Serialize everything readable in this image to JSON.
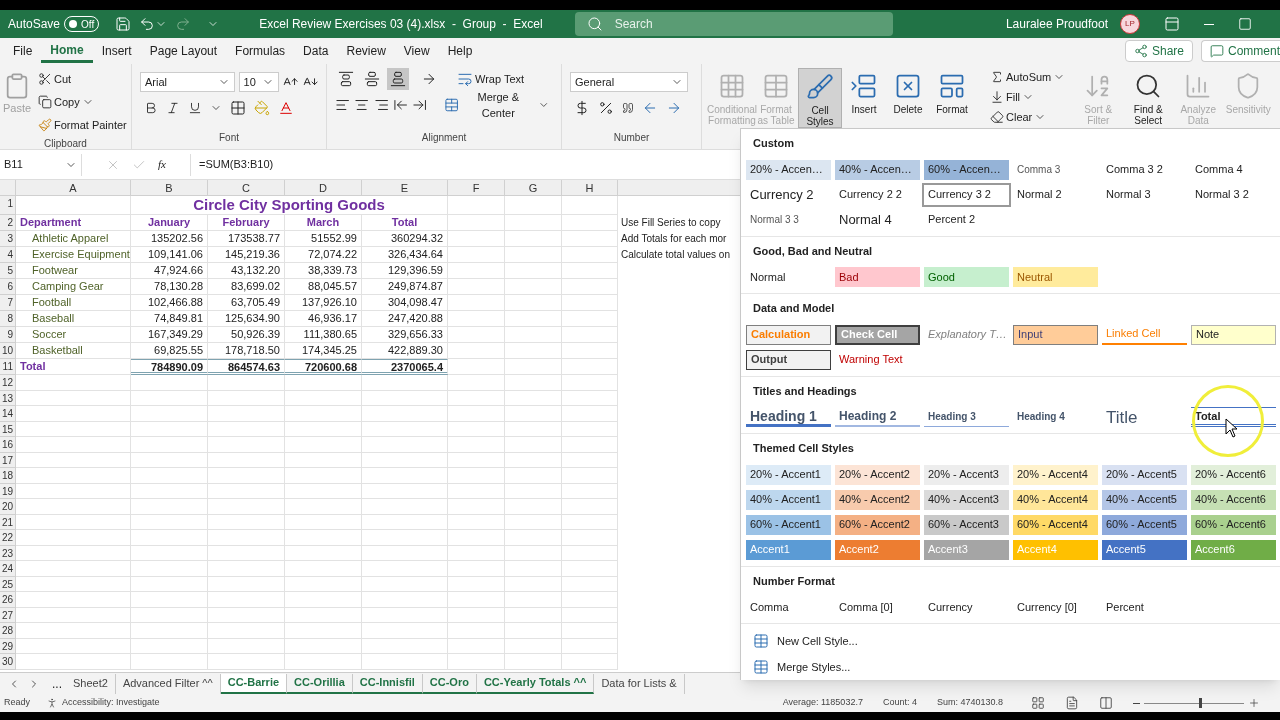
{
  "title_bar": {
    "autosave_label": "AutoSave",
    "autosave": {
      "on": false,
      "label": "Off"
    },
    "document_title": "Excel Review Exercises 03 (4).xlsx  -  Group  -  Excel",
    "search_placeholder": "Search",
    "user_name": "Lauralee Proudfoot",
    "user_initials": "LP"
  },
  "menu_tabs": [
    {
      "label": "File",
      "selected": false
    },
    {
      "label": "Home",
      "selected": true
    },
    {
      "label": "Insert",
      "selected": false
    },
    {
      "label": "Page Layout",
      "selected": false
    },
    {
      "label": "Formulas",
      "selected": false
    },
    {
      "label": "Data",
      "selected": false
    },
    {
      "label": "Review",
      "selected": false
    },
    {
      "label": "View",
      "selected": false
    },
    {
      "label": "Help",
      "selected": false
    }
  ],
  "share_label": "Share",
  "comments_label": "Comment",
  "ribbon": {
    "clipboard": {
      "label": "Clipboard",
      "paste": {
        "label": "Paste",
        "disabled": true
      },
      "cut": "Cut",
      "copy": "Copy",
      "format_painter": "Format Painter"
    },
    "font": {
      "label": "Font",
      "name": "Arial",
      "size": "10"
    },
    "alignment": {
      "label": "Alignment",
      "wrap_text": "Wrap Text",
      "merge": "Merge & Center",
      "vertical_align": [
        {
          "selected": false
        },
        {
          "selected": false
        },
        {
          "selected": true
        }
      ]
    },
    "number": {
      "label": "Number",
      "format": "General"
    },
    "big_buttons": [
      {
        "label": "Conditional Formatting",
        "disabled": true,
        "selected": false
      },
      {
        "label": "Format as Table",
        "disabled": true,
        "selected": false
      },
      {
        "label": "Cell Styles",
        "disabled": false,
        "selected": true
      },
      {
        "label": "Insert",
        "disabled": false,
        "selected": false
      },
      {
        "label": "Delete",
        "disabled": false,
        "selected": false
      },
      {
        "label": "Format",
        "disabled": false,
        "selected": false
      }
    ],
    "editing": [
      "AutoSum",
      "Fill",
      "Clear"
    ],
    "right_buttons": [
      {
        "label": "Sort & Filter",
        "disabled": true
      },
      {
        "label": "Find & Select",
        "disabled": false
      },
      {
        "label": "Analyze Data",
        "disabled": true
      },
      {
        "label": "Sensitivity",
        "disabled": true
      }
    ]
  },
  "formula_bar": {
    "name_box": "B11",
    "fx": "fx",
    "formula": "=SUM(B3:B10)"
  },
  "sheet": {
    "columns": [
      "A",
      "B",
      "C",
      "D",
      "E",
      "F",
      "G",
      "H"
    ],
    "row_numbers": [
      "1",
      "2",
      "3",
      "4",
      "5",
      "6",
      "7",
      "8",
      "9",
      "10",
      "11",
      "12",
      "13",
      "14",
      "15",
      "16",
      "17",
      "18",
      "19",
      "20",
      "21",
      "22",
      "23",
      "24",
      "25",
      "26",
      "27",
      "28",
      "29",
      "30"
    ],
    "title": "Circle City Sporting Goods",
    "header": [
      "Department",
      "January",
      "February",
      "March",
      "Total"
    ],
    "rows": [
      [
        "Athletic Apparel",
        "135202.56",
        "173538.77",
        "51552.99",
        "360294.32"
      ],
      [
        "Exercise Equipment",
        "109,141.06",
        "145,219.36",
        "72,074.22",
        "326,434.64"
      ],
      [
        "Footwear",
        "47,924.66",
        "43,132.20",
        "38,339.73",
        "129,396.59"
      ],
      [
        "Camping Gear",
        "78,130.28",
        "83,699.02",
        "88,045.57",
        "249,874.87"
      ],
      [
        "Football",
        "102,466.88",
        "63,705.49",
        "137,926.10",
        "304,098.47"
      ],
      [
        "Baseball",
        "74,849.81",
        "125,634.90",
        "46,936.17",
        "247,420.88"
      ],
      [
        "Soccer",
        "167,349.29",
        "50,926.39",
        "111,380.65",
        "329,656.33"
      ],
      [
        "Basketball",
        "69,825.55",
        "178,718.50",
        "174,345.25",
        "422,889.30"
      ]
    ],
    "total_row": [
      "Total",
      "784890.09",
      "864574.63",
      "720600.68",
      "2370065.4"
    ],
    "notes": [
      "Use Fill Series to copy",
      "Add Totals for each mor",
      "Calculate total values on"
    ]
  },
  "sheet_tabs": [
    {
      "label": "Sheet2",
      "selected": false,
      "active": false
    },
    {
      "label": "Advanced Filter ^^",
      "selected": false,
      "active": false
    },
    {
      "label": "CC-Barrie",
      "selected": true,
      "active": true
    },
    {
      "label": "CC-Orillia",
      "selected": true,
      "active": false
    },
    {
      "label": "CC-Innisfil",
      "selected": true,
      "active": false
    },
    {
      "label": "CC-Oro",
      "selected": true,
      "active": false
    },
    {
      "label": "CC-Yearly Totals ^^",
      "selected": true,
      "active": false
    },
    {
      "label": "Data for Lists &",
      "selected": false,
      "active": false
    }
  ],
  "sheet_tabs_more": "...",
  "status_bar": {
    "mode": "Ready",
    "accessibility": "Accessibility: Investigate",
    "average": "Average: 1185032.7",
    "count": "Count: 4",
    "sum": "Sum: 4740130.8",
    "zoom": {
      "level": 0.55
    }
  },
  "gallery": [
    {
      "title": "Custom",
      "items": [
        {
          "label": "20% - Accen…",
          "kind": "tint",
          "color": "#dce6f1",
          "selected": false
        },
        {
          "label": "40% - Accen…",
          "kind": "tint",
          "color": "#b8cce4",
          "selected": false
        },
        {
          "label": "60% - Accen…",
          "kind": "tint",
          "color": "#95b3d7",
          "selected": false
        },
        {
          "label": "Comma 3",
          "kind": "small",
          "selected": false
        },
        {
          "label": "Comma 3 2",
          "kind": "normal",
          "selected": false
        },
        {
          "label": "Comma 4",
          "kind": "normal",
          "selected": false
        },
        {
          "label": "Currency 2",
          "kind": "large",
          "selected": false
        },
        {
          "label": "Currency 2 2",
          "kind": "normal",
          "selected": false
        },
        {
          "label": "Currency 3 2",
          "kind": "normal",
          "selected": true
        },
        {
          "label": "Normal 2",
          "kind": "normal",
          "selected": false
        },
        {
          "label": "Normal 3",
          "kind": "normal",
          "selected": false
        },
        {
          "label": "Normal 3 2",
          "kind": "normal",
          "selected": false
        },
        {
          "label": "Normal 3 3",
          "kind": "small",
          "selected": false
        },
        {
          "label": "Normal 4",
          "kind": "large",
          "selected": false
        },
        {
          "label": "Percent 2",
          "kind": "normal",
          "selected": false
        }
      ]
    },
    {
      "title": "Good, Bad and Neutral",
      "items": [
        {
          "label": "Normal",
          "kind": "normal",
          "selected": false
        },
        {
          "label": "Bad",
          "kind": "bad",
          "selected": false
        },
        {
          "label": "Good",
          "kind": "good",
          "selected": false
        },
        {
          "label": "Neutral",
          "kind": "neutral",
          "selected": false
        }
      ]
    },
    {
      "title": "Data and Model",
      "items": [
        {
          "label": "Calculation",
          "kind": "calculation",
          "selected": false
        },
        {
          "label": "Check Cell",
          "kind": "check",
          "selected": false
        },
        {
          "label": "Explanatory T…",
          "kind": "explanatory",
          "selected": false
        },
        {
          "label": "Input",
          "kind": "input",
          "selected": false
        },
        {
          "label": "Linked Cell",
          "kind": "linked",
          "selected": false
        },
        {
          "label": "Note",
          "kind": "note",
          "selected": false
        },
        {
          "label": "Output",
          "kind": "output",
          "selected": false
        },
        {
          "label": "Warning Text",
          "kind": "warning",
          "selected": false
        }
      ]
    },
    {
      "title": "Titles and Headings",
      "items": [
        {
          "label": "Heading 1",
          "kind": "heading1",
          "selected": false
        },
        {
          "label": "Heading 2",
          "kind": "heading2",
          "selected": false
        },
        {
          "label": "Heading 3",
          "kind": "heading3",
          "selected": false
        },
        {
          "label": "Heading 4",
          "kind": "heading4",
          "selected": false
        },
        {
          "label": "Title",
          "kind": "title",
          "selected": false
        },
        {
          "label": "Total",
          "kind": "total",
          "selected": false
        }
      ]
    },
    {
      "title": "Themed Cell Styles",
      "items": [
        {
          "label": "20% - Accent1",
          "kind": "tint",
          "color": "#ddebf7",
          "selected": false
        },
        {
          "label": "20% - Accent2",
          "kind": "tint",
          "color": "#fce4d6",
          "selected": false
        },
        {
          "label": "20% - Accent3",
          "kind": "tint",
          "color": "#ededed",
          "selected": false
        },
        {
          "label": "20% - Accent4",
          "kind": "tint",
          "color": "#fff2cc",
          "selected": false
        },
        {
          "label": "20% - Accent5",
          "kind": "tint",
          "color": "#d9e1f2",
          "selected": false
        },
        {
          "label": "20% - Accent6",
          "kind": "tint",
          "color": "#e2efda",
          "selected": false
        },
        {
          "label": "40% - Accent1",
          "kind": "tint",
          "color": "#bdd7ee",
          "selected": false
        },
        {
          "label": "40% - Accent2",
          "kind": "tint",
          "color": "#f8cbad",
          "selected": false
        },
        {
          "label": "40% - Accent3",
          "kind": "tint",
          "color": "#dbdbdb",
          "selected": false
        },
        {
          "label": "40% - Accent4",
          "kind": "tint",
          "color": "#ffe699",
          "selected": false
        },
        {
          "label": "40% - Accent5",
          "kind": "tint",
          "color": "#b4c6e7",
          "selected": false
        },
        {
          "label": "40% - Accent6",
          "kind": "tint",
          "color": "#c6e0b4",
          "selected": false
        },
        {
          "label": "60% - Accent1",
          "kind": "tint",
          "color": "#9bc2e6",
          "selected": false
        },
        {
          "label": "60% - Accent2",
          "kind": "tint",
          "color": "#f4b084",
          "selected": false
        },
        {
          "label": "60% - Accent3",
          "kind": "tint",
          "color": "#c9c9c9",
          "selected": false
        },
        {
          "label": "60% - Accent4",
          "kind": "tint",
          "color": "#ffd966",
          "selected": false
        },
        {
          "label": "60% - Accent5",
          "kind": "tint",
          "color": "#8ea9db",
          "selected": false
        },
        {
          "label": "60% - Accent6",
          "kind": "tint",
          "color": "#a9d08e",
          "selected": false
        },
        {
          "label": "Accent1",
          "kind": "accent",
          "color": "#5b9bd5",
          "selected": false
        },
        {
          "label": "Accent2",
          "kind": "accent",
          "color": "#ed7d31",
          "selected": false
        },
        {
          "label": "Accent3",
          "kind": "accent",
          "color": "#a5a5a5",
          "selected": false
        },
        {
          "label": "Accent4",
          "kind": "accent",
          "color": "#ffc000",
          "selected": false
        },
        {
          "label": "Accent5",
          "kind": "accent",
          "color": "#4472c4",
          "selected": false
        },
        {
          "label": "Accent6",
          "kind": "accent",
          "color": "#70ad47",
          "selected": false
        }
      ]
    },
    {
      "title": "Number Format",
      "items": [
        {
          "label": "Comma",
          "kind": "normal",
          "selected": false
        },
        {
          "label": "Comma [0]",
          "kind": "normal",
          "selected": false
        },
        {
          "label": "Currency",
          "kind": "normal",
          "selected": false
        },
        {
          "label": "Currency [0]",
          "kind": "normal",
          "selected": false
        },
        {
          "label": "Percent",
          "kind": "normal",
          "selected": false
        }
      ]
    }
  ],
  "gallery_actions": [
    "New Cell Style...",
    "Merge Styles..."
  ]
}
